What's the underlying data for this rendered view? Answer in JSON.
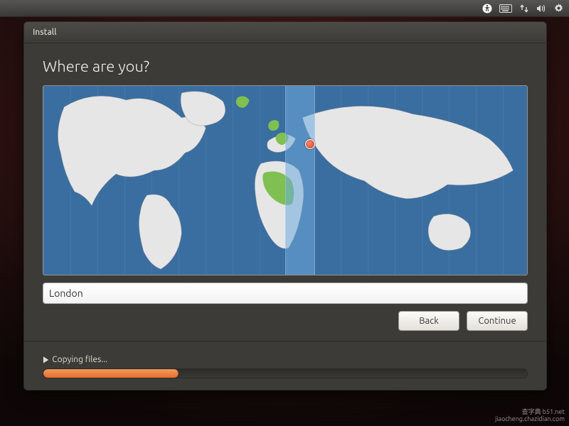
{
  "tray": {
    "icons": [
      "accessibility",
      "keyboard",
      "network",
      "sound",
      "settings"
    ]
  },
  "window": {
    "title": "Install",
    "heading": "Where are you?"
  },
  "location": {
    "value": "London"
  },
  "buttons": {
    "back": "Back",
    "continue": "Continue"
  },
  "progress": {
    "label": "Copying files...",
    "percent": 28
  },
  "map": {
    "selected_timezone_band_index": 9,
    "pin": {
      "city": "London"
    }
  },
  "watermark": {
    "line1": "查字典 b51.net",
    "line2": "jiaocheng.chazidian.com"
  }
}
